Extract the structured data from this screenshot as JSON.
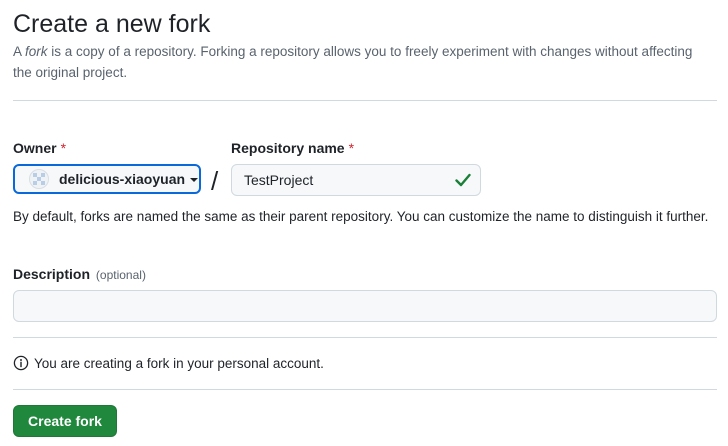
{
  "header": {
    "title": "Create a new fork",
    "subtitle_prefix": "A ",
    "subtitle_emphasis": "fork",
    "subtitle_rest": " is a copy of a repository. Forking a repository allows you to freely experiment with changes without affecting the original project."
  },
  "form": {
    "owner": {
      "label": "Owner",
      "required_marker": "*",
      "selected_value": "delicious-xiaoyuan",
      "dropdown_icon": "triangle-down-icon",
      "avatar_icon": "identicon-avatar"
    },
    "separator": "/",
    "repository_name": {
      "label": "Repository name",
      "required_marker": "*",
      "value": "TestProject",
      "status_icon": "check-icon",
      "status_color": "#1a7f37"
    },
    "hint": "By default, forks are named the same as their parent repository. You can customize the name to distinguish it further.",
    "description": {
      "label": "Description",
      "optional_label": "(optional)",
      "value": "",
      "placeholder": ""
    }
  },
  "notice": {
    "icon": "info-icon",
    "text": "You are creating a fork in your personal account."
  },
  "actions": {
    "create_label": "Create fork",
    "create_color": "#1f883d"
  },
  "colors": {
    "accent": "#0969da",
    "required": "#d1242f",
    "muted_text": "#59636e",
    "border": "#d1d9e0"
  }
}
